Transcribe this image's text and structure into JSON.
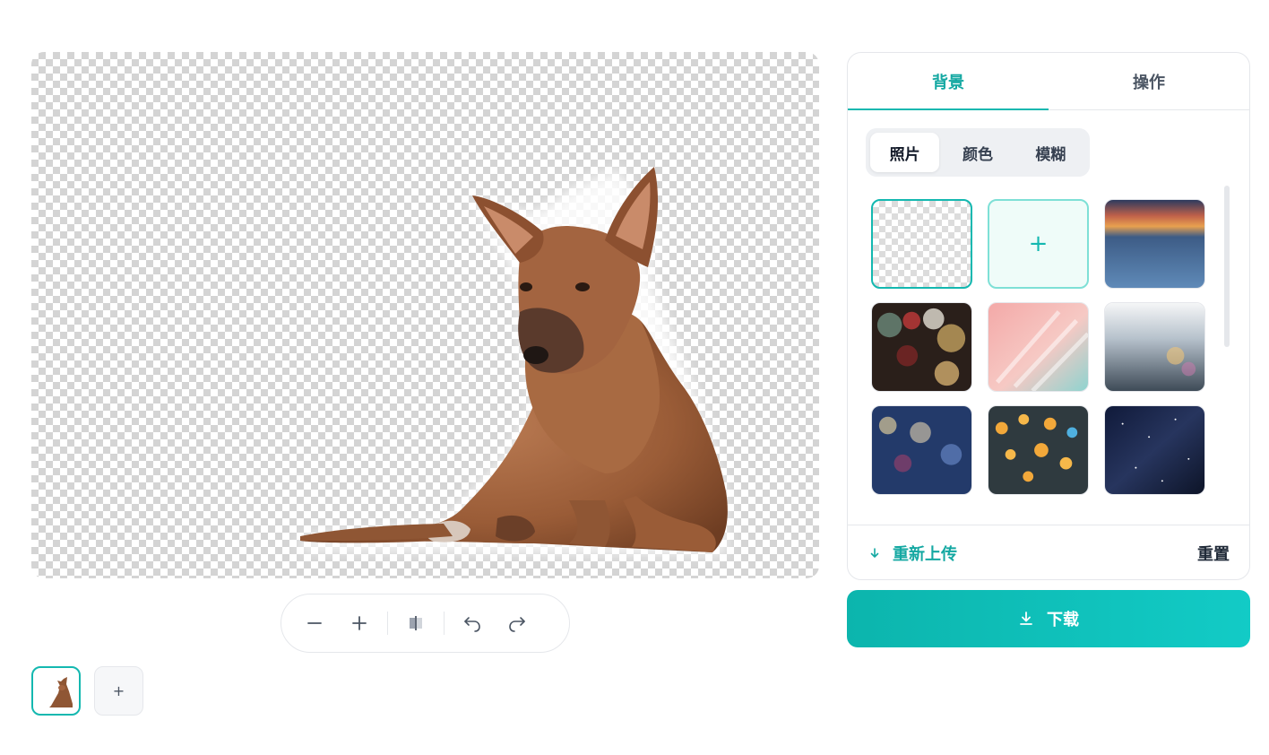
{
  "panel": {
    "tabs": [
      {
        "label": "背景",
        "active": true
      },
      {
        "label": "操作",
        "active": false
      }
    ],
    "segments": [
      {
        "label": "照片",
        "active": true
      },
      {
        "label": "颜色",
        "active": false
      },
      {
        "label": "模糊",
        "active": false
      }
    ],
    "upload_tile_symbol": "+",
    "backgrounds": [
      "transparent",
      "upload",
      "sunset-sea",
      "bokeh-dark",
      "pink-brush",
      "rain-window",
      "city-rain",
      "orange-bokeh",
      "starry-sky"
    ],
    "footer": {
      "reupload_label": "重新上传",
      "reset_label": "重置"
    }
  },
  "download_label": "下载",
  "thumbnails": {
    "add_symbol": "+"
  },
  "colors": {
    "accent": "#14b8b0",
    "accent_dark": "#14a8a2"
  }
}
